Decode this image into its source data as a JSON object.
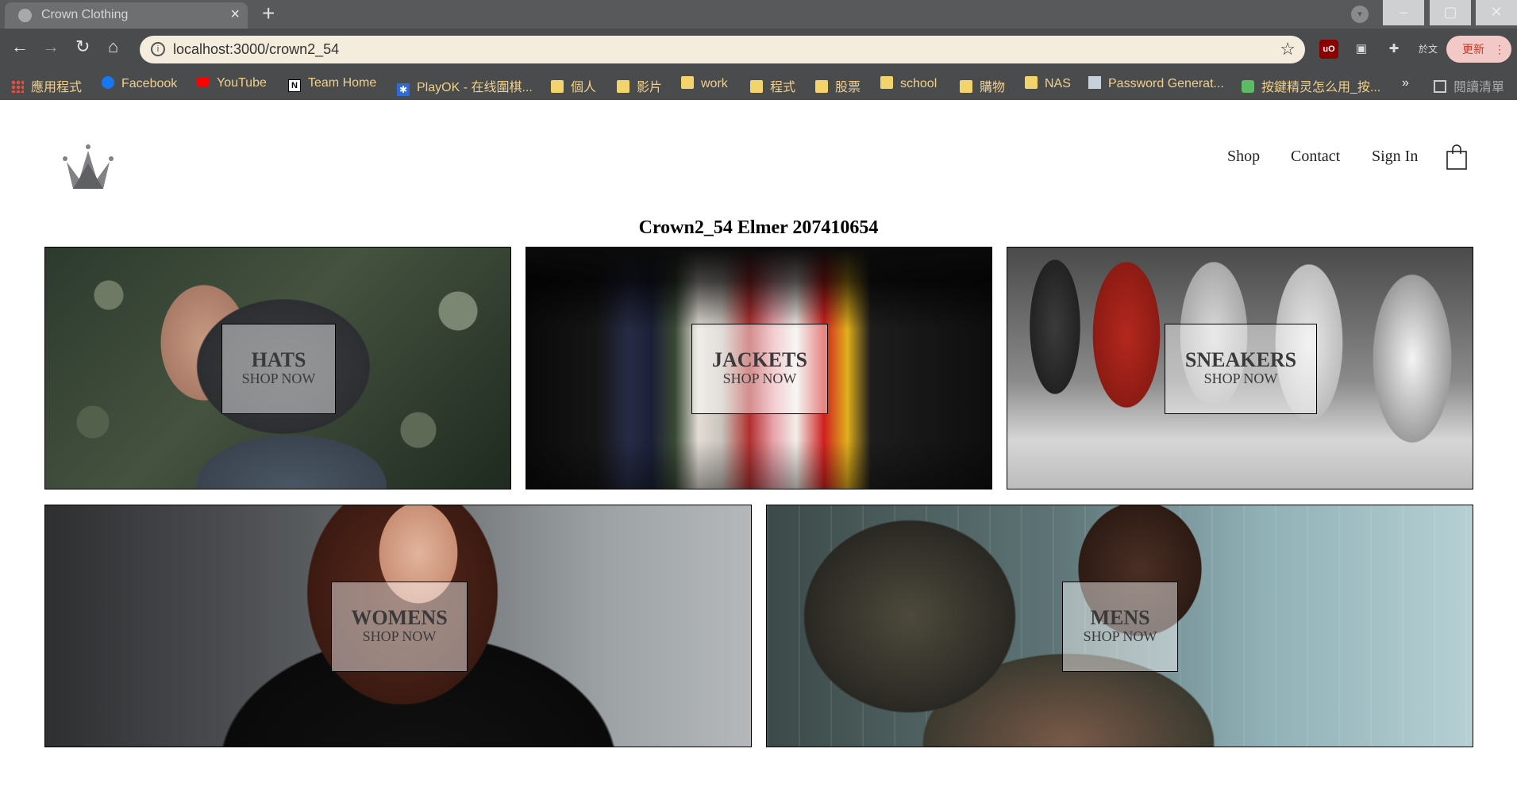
{
  "browser": {
    "tab_title": "Crown Clothing",
    "url": "localhost:3000/crown2_54",
    "update_label": "更新",
    "translate_label": "於文",
    "reading_list_label": "閱讀清單",
    "more_bookmarks": "»",
    "bookmarks": [
      {
        "label": "應用程式",
        "icon": "apps-grid-icon"
      },
      {
        "label": "Facebook",
        "icon": "facebook-icon"
      },
      {
        "label": "YouTube",
        "icon": "youtube-icon"
      },
      {
        "label": "Team Home",
        "icon": "notion-icon"
      },
      {
        "label": "PlayOK - 在线圍棋...",
        "icon": "playok-icon"
      },
      {
        "label": "個人",
        "icon": "folder-icon"
      },
      {
        "label": "影片",
        "icon": "folder-icon"
      },
      {
        "label": "work",
        "icon": "folder-icon"
      },
      {
        "label": "程式",
        "icon": "folder-icon"
      },
      {
        "label": "股票",
        "icon": "folder-icon"
      },
      {
        "label": "school",
        "icon": "folder-icon"
      },
      {
        "label": "購物",
        "icon": "folder-icon"
      },
      {
        "label": "NAS",
        "icon": "folder-icon"
      },
      {
        "label": "Password Generat...",
        "icon": "page-icon"
      },
      {
        "label": "按鍵精灵怎么用_按...",
        "icon": "image-icon"
      }
    ]
  },
  "header": {
    "nav": [
      {
        "label": "Shop"
      },
      {
        "label": "Contact"
      },
      {
        "label": "Sign In"
      }
    ]
  },
  "page": {
    "title": "Crown2_54 Elmer 207410654"
  },
  "directory": [
    {
      "title": "HATS",
      "subtitle": "SHOP NOW"
    },
    {
      "title": "JACKETS",
      "subtitle": "SHOP NOW"
    },
    {
      "title": "SNEAKERS",
      "subtitle": "SHOP NOW"
    },
    {
      "title": "WOMENS",
      "subtitle": "SHOP NOW"
    },
    {
      "title": "MENS",
      "subtitle": "SHOP NOW"
    }
  ],
  "colors": {
    "tab_bar": "#58595b",
    "toolbar": "#4a4b4d",
    "omnibox": "#f4ecdc",
    "bookmark_text": "#f0d08c",
    "tile_border": "#000000"
  }
}
